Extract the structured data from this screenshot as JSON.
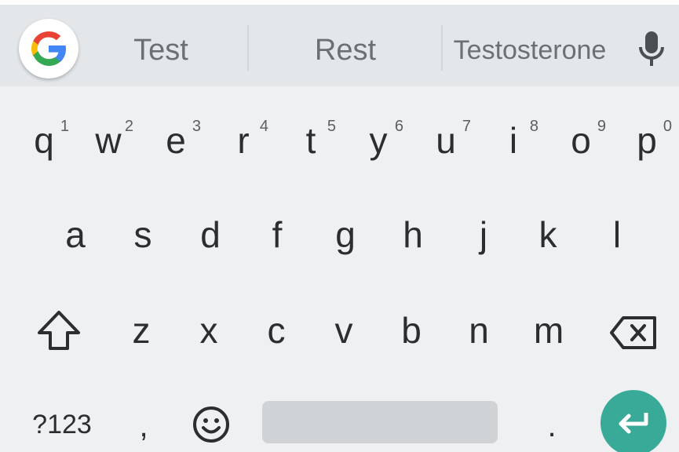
{
  "colors": {
    "background": "#eef0f2",
    "suggestion_bar": "#e4e7ea",
    "key_text": "#2b2e31",
    "suggestion_text": "#6b7075",
    "spacebar": "#cfd3d6",
    "enter": "#3aaa98"
  },
  "suggestions": {
    "items": [
      {
        "label": "Test"
      },
      {
        "label": "Rest"
      },
      {
        "label": "Testosterone"
      }
    ],
    "g_icon": "google-icon",
    "mic_icon": "microphone-icon"
  },
  "rows": {
    "row1": [
      {
        "label": "q",
        "hint": "1"
      },
      {
        "label": "w",
        "hint": "2"
      },
      {
        "label": "e",
        "hint": "3"
      },
      {
        "label": "r",
        "hint": "4"
      },
      {
        "label": "t",
        "hint": "5"
      },
      {
        "label": "y",
        "hint": "6"
      },
      {
        "label": "u",
        "hint": "7"
      },
      {
        "label": "i",
        "hint": "8"
      },
      {
        "label": "o",
        "hint": "9"
      },
      {
        "label": "p",
        "hint": "0"
      }
    ],
    "row2": [
      {
        "label": "a"
      },
      {
        "label": "s"
      },
      {
        "label": "d"
      },
      {
        "label": "f"
      },
      {
        "label": "g"
      },
      {
        "label": "h"
      },
      {
        "label": "j"
      },
      {
        "label": "k"
      },
      {
        "label": "l"
      }
    ],
    "row3": [
      {
        "label": "z"
      },
      {
        "label": "x"
      },
      {
        "label": "c"
      },
      {
        "label": "v"
      },
      {
        "label": "b"
      },
      {
        "label": "n"
      },
      {
        "label": "m"
      }
    ],
    "shift_icon": "shift-icon",
    "backspace_icon": "backspace-icon"
  },
  "bottom": {
    "symbols_label": "?123",
    "comma_label": ",",
    "emoji_icon": "emoji-icon",
    "period_label": ".",
    "enter_icon": "enter-icon"
  }
}
